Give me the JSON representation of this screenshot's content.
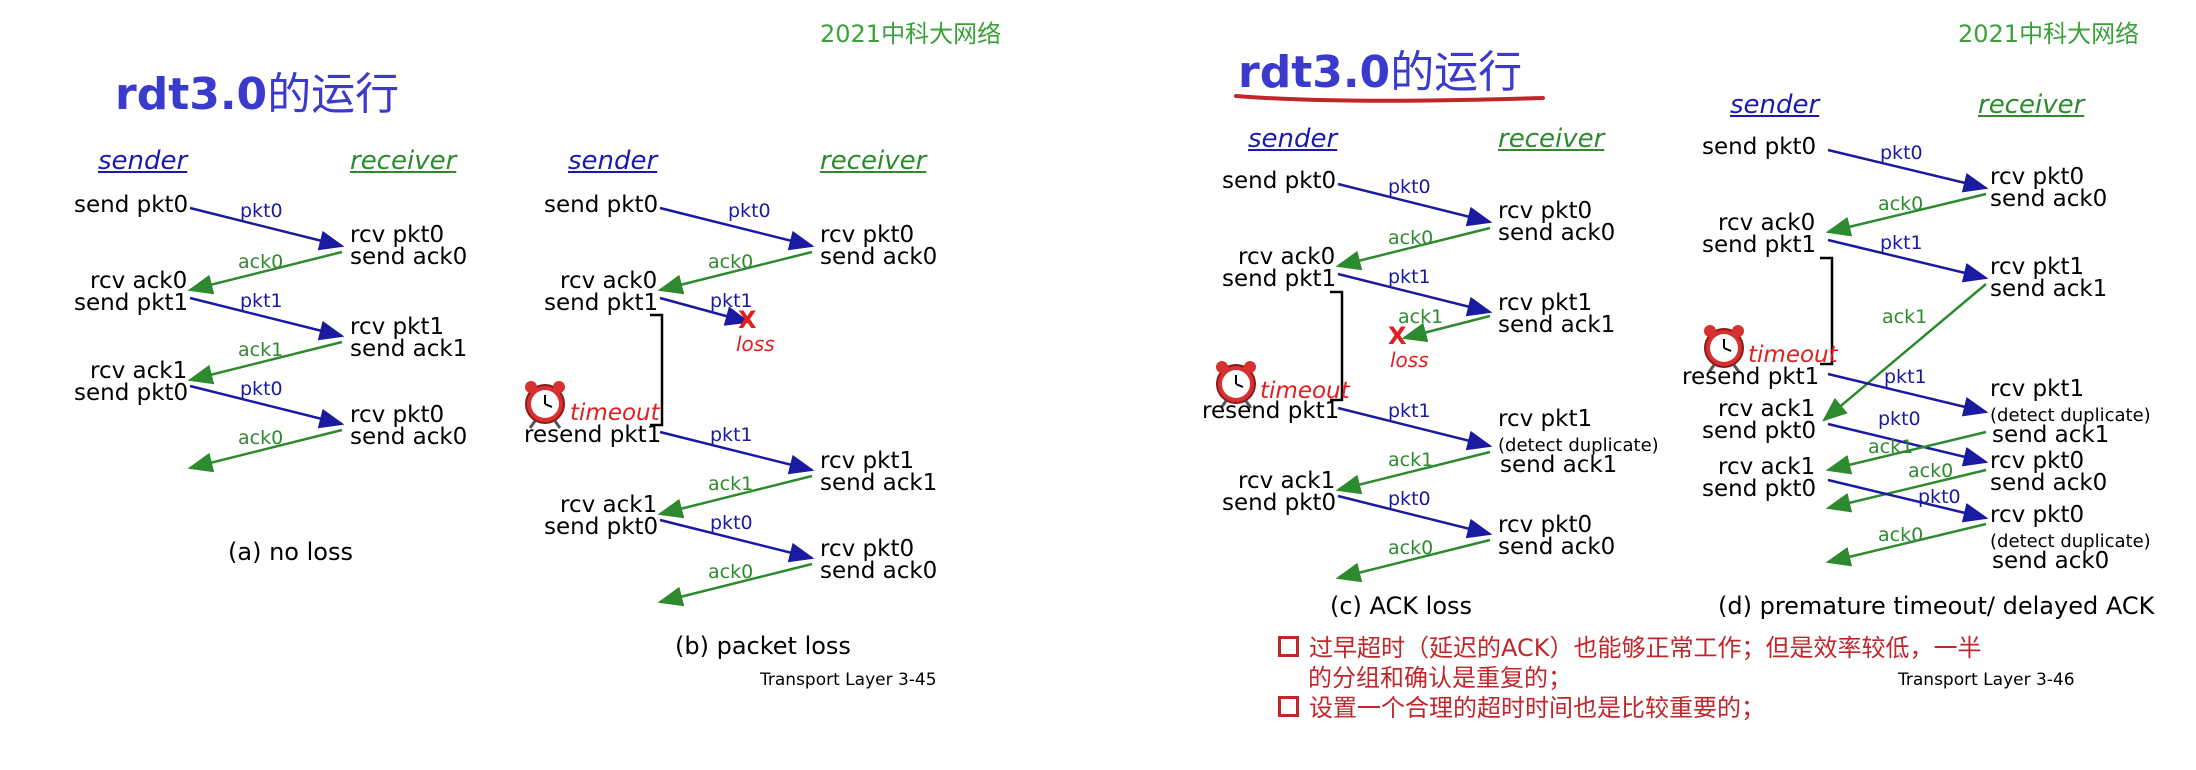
{
  "course": "2021中科大网络",
  "title_latin": "rdt3.0",
  "title_cn": "的运行",
  "sender": "sender",
  "receiver": "receiver",
  "events": {
    "send_pkt0": "send pkt0",
    "send_pkt1": "send pkt1",
    "rcv_pkt0": "rcv pkt0",
    "rcv_pkt1": "rcv pkt1",
    "send_ack0": "send ack0",
    "send_ack1": "send ack1",
    "rcv_ack0": "rcv ack0",
    "rcv_ack1": "rcv ack1",
    "resend_pkt1": "resend pkt1",
    "detect_duplicate": "(detect duplicate)"
  },
  "labels": {
    "pkt0": "pkt0",
    "pkt1": "pkt1",
    "ack0": "ack0",
    "ack1": "ack1",
    "x": "X",
    "loss": "loss",
    "timeout": "timeout"
  },
  "captions": {
    "a": "(a) no loss",
    "b": "(b) packet loss",
    "c": "(c) ACK loss",
    "d": "(d) premature timeout/ delayed ACK"
  },
  "footer_left": "Transport Layer   3-45",
  "footer_right": "Transport Layer   3-46",
  "notes": [
    "过早超时（延迟的ACK）也能够正常工作；但是效率较低，一半",
    "的分组和确认是重复的；",
    "设置一个合理的超时时间也是比较重要的；"
  ],
  "colors": {
    "pkt": "#1a1aa0",
    "ack": "#2e8a2e",
    "title": "#3a3acc",
    "course": "#3aa13a",
    "alert": "#e02020",
    "note": "#c0262a"
  },
  "icons": [
    "alarm-clock-icon",
    "loss-x-icon"
  ]
}
